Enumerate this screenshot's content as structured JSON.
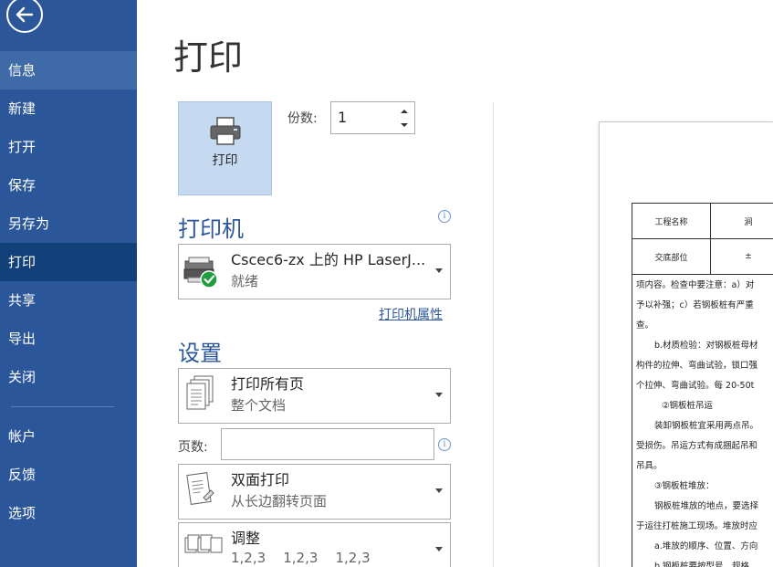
{
  "sidebar": {
    "back_label": "",
    "items": [
      {
        "label": "信息"
      },
      {
        "label": "新建"
      },
      {
        "label": "打开"
      },
      {
        "label": "保存"
      },
      {
        "label": "另存为"
      },
      {
        "label": "打印"
      },
      {
        "label": "共享"
      },
      {
        "label": "导出"
      },
      {
        "label": "关闭"
      }
    ],
    "bottom_items": [
      {
        "label": "帐户"
      },
      {
        "label": "反馈"
      },
      {
        "label": "选项"
      }
    ]
  },
  "main": {
    "title": "打印",
    "print_button_label": "打印",
    "copies_label": "份数:",
    "copies_value": "1",
    "printer_section_title": "打印机",
    "printer": {
      "name": "Cscec6-zx 上的 HP LaserJ...",
      "status": "就绪"
    },
    "printer_properties_link": "打印机属性",
    "settings_section_title": "设置",
    "settings": [
      {
        "main": "打印所有页",
        "sub": "整个文档",
        "icon": "pages-icon"
      },
      {
        "main": "双面打印",
        "sub": "从长边翻转页面",
        "icon": "duplex-icon"
      },
      {
        "main": "调整",
        "sub": "1,2,3    1,2,3    1,2,3",
        "icon": "collate-icon"
      }
    ],
    "pages_label": "页数:",
    "pages_value": ""
  },
  "preview": {
    "table": [
      [
        "工程名称",
        "涧"
      ],
      [
        "交底部位",
        "±"
      ]
    ],
    "lines": [
      "项内容。检查中要注意：a）对",
      "予以补强；c）若钢板桩有严重",
      "查。",
      "b.材质检验：对钢板桩母材",
      "构件的拉伸、弯曲试验，锁口强",
      "个拉伸、弯曲试验。每 20-50t",
      "②钢板桩吊运",
      "装卸钢板桩宜采用两点吊。",
      "受损伤。吊运方式有成捆起吊和",
      "吊具。",
      "③钢板桩堆放：",
      "钢板桩堆放的地点，要选择",
      "于运往打桩施工现场。堆放时应",
      "a.堆放的顺序、位置、方向",
      "b.钢板桩要按型号、规格"
    ]
  },
  "colors": {
    "sidebar_bg": "#2b579a",
    "sidebar_active": "#124078",
    "accent": "#2b579a",
    "print_button_bg": "#c5d9f1"
  }
}
